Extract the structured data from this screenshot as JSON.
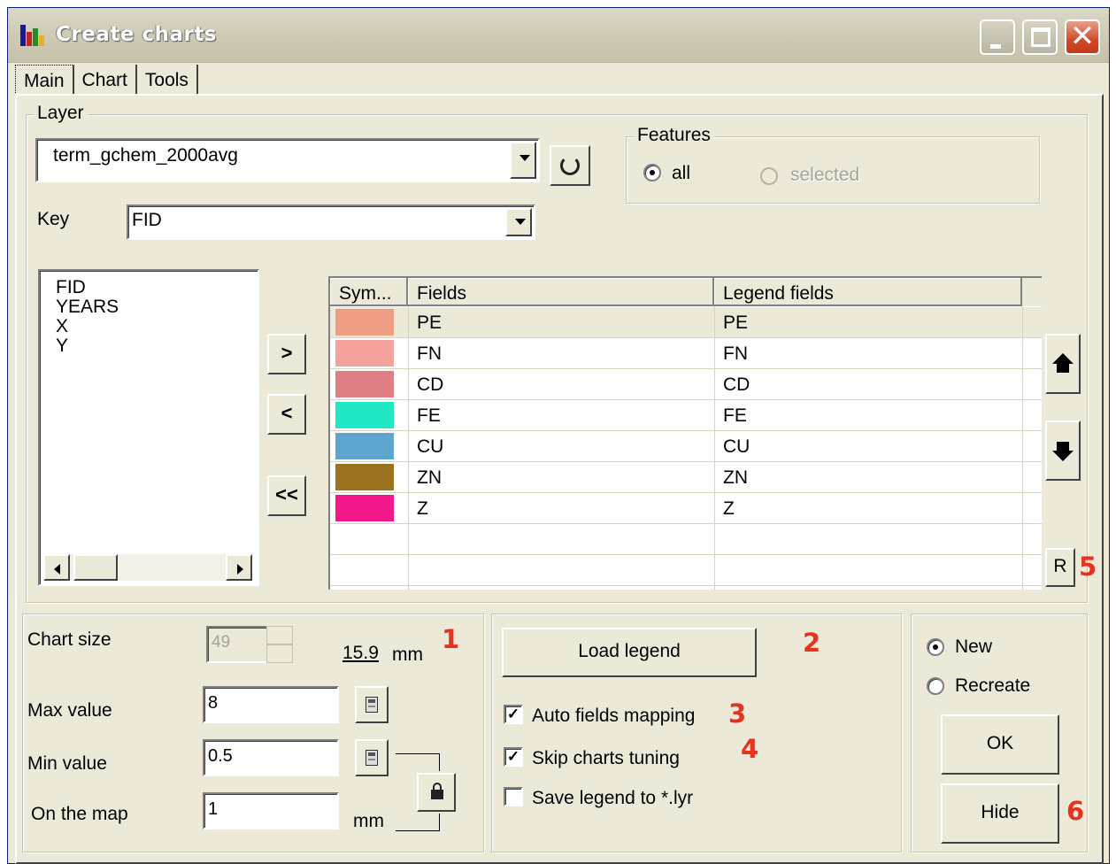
{
  "window": {
    "title": "Create charts"
  },
  "tabs": [
    {
      "label": "Main",
      "active": true
    },
    {
      "label": "Chart",
      "active": false
    },
    {
      "label": "Tools",
      "active": false
    }
  ],
  "layer": {
    "group_label": "Layer",
    "selected": "term_gchem_2000avg",
    "key_label": "Key",
    "key_value": "FID"
  },
  "features": {
    "group_label": "Features",
    "options": [
      {
        "label": "all",
        "checked": true,
        "enabled": true
      },
      {
        "label": "selected",
        "checked": false,
        "enabled": false
      }
    ]
  },
  "available_fields": [
    "FID",
    "YEARS",
    "X",
    "Y"
  ],
  "move_buttons": {
    "add": ">",
    "remove": "<",
    "remove_all": "<<"
  },
  "grid": {
    "columns": [
      "Sym...",
      "Fields",
      "Legend fields"
    ],
    "rows": [
      {
        "color": "#ef9d83",
        "field": "PE",
        "legend": "PE"
      },
      {
        "color": "#f4a39c",
        "field": "FN",
        "legend": "FN"
      },
      {
        "color": "#e07e86",
        "field": "CD",
        "legend": "CD"
      },
      {
        "color": "#1fe8c3",
        "field": "FE",
        "legend": "FE"
      },
      {
        "color": "#5ea5cf",
        "field": "CU",
        "legend": "CU"
      },
      {
        "color": "#9a7220",
        "field": "ZN",
        "legend": "ZN"
      },
      {
        "color": "#f3188a",
        "field": "Z",
        "legend": "Z"
      }
    ]
  },
  "reset_button": "R",
  "chart_size": {
    "label": "Chart size",
    "value": "49",
    "mm_value": "15.9",
    "mm_unit": "mm",
    "max_label": "Max value",
    "max_value": "8",
    "min_label": "Min value",
    "min_value": "0.5",
    "onmap_label": "On the map",
    "onmap_value": "1",
    "onmap_unit": "mm"
  },
  "legend": {
    "load_button": "Load legend",
    "options": [
      {
        "label": "Auto fields mapping",
        "checked": true
      },
      {
        "label": "Skip charts tuning",
        "checked": true
      },
      {
        "label": "Save legend to *.lyr",
        "checked": false
      }
    ]
  },
  "mode": {
    "options": [
      {
        "label": "New",
        "checked": true
      },
      {
        "label": "Recreate",
        "checked": false
      }
    ],
    "ok_button": "OK",
    "hide_button": "Hide"
  },
  "callouts": [
    "1",
    "2",
    "3",
    "4",
    "5",
    "6"
  ],
  "colors": {
    "callout": "#e8321e",
    "background": "#ece9d8"
  }
}
